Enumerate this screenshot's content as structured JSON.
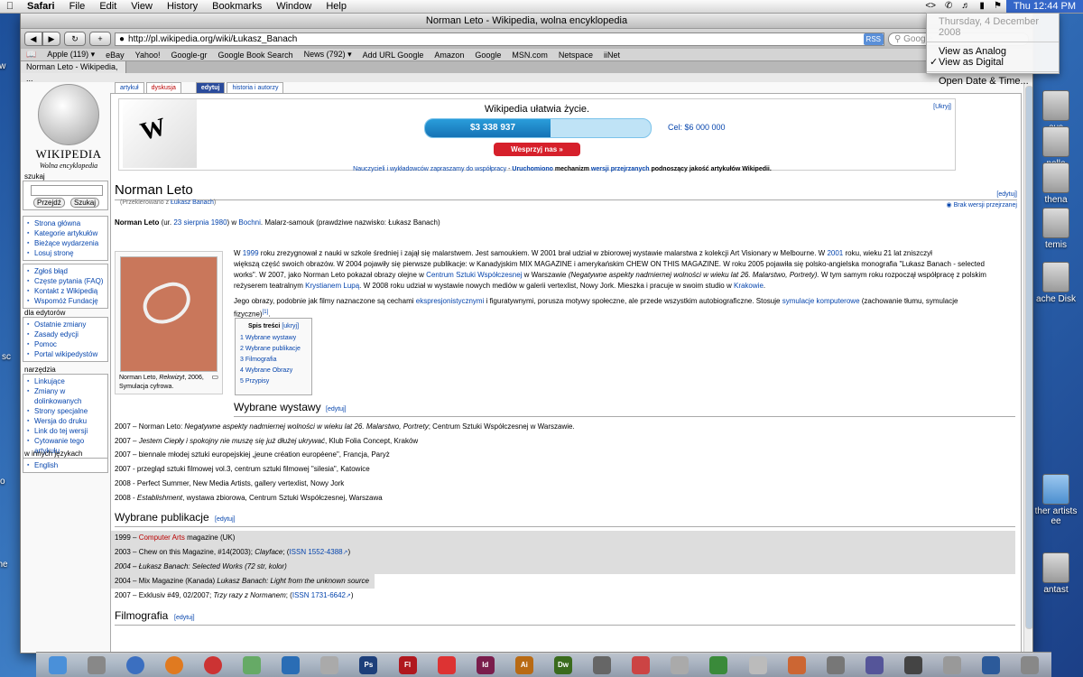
{
  "menubar": {
    "app": "Safari",
    "items": [
      "File",
      "Edit",
      "View",
      "History",
      "Bookmarks",
      "Window",
      "Help"
    ],
    "clock": "Thu 12:44 PM"
  },
  "clock_menu": {
    "date": "Thursday, 4 December 2008",
    "analog": "View as Analog",
    "digital": "View as Digital",
    "open_prefs": "Open Date & Time..."
  },
  "window": {
    "title": "Norman Leto - Wikipedia, wolna encyklopedia",
    "url": "http://pl.wikipedia.org/wiki/Łukasz_Banach",
    "rss": "RSS",
    "search_placeholder": "Google",
    "tab": "Norman Leto - Wikipedia, ...",
    "bookmarks": [
      "Apple (119) ▾",
      "eBay",
      "Yahoo!",
      "Google-gr",
      "Google Book Search",
      "News (792) ▾",
      "Add URL Google",
      "Amazon",
      "Google",
      "MSN.com",
      "Netspace",
      "iiNet"
    ]
  },
  "desktop": {
    "icons": [
      "eus",
      "pollo",
      "thena",
      "temis",
      "ache Disk",
      "ther artists ee",
      "antast"
    ],
    "left_labels": [
      "ow",
      "do sc",
      "bo",
      "The"
    ]
  },
  "wiki": {
    "logo_title": "WIKIPEDIA",
    "logo_sub": "Wolna encyklopedia",
    "search_label": "szukaj",
    "btn_go": "Przejdź",
    "btn_search": "Szukaj",
    "nav": [
      "Strona główna",
      "Kategorie artykułów",
      "Bieżące wydarzenia",
      "Losuj stronę"
    ],
    "help": [
      "Zgłoś błąd",
      "Częste pytania (FAQ)",
      "Kontakt z Wikipedią",
      "Wspomóż Fundację"
    ],
    "editors_label": "dla edytorów",
    "editors": [
      "Ostatnie zmiany",
      "Zasady edycji",
      "Pomoc",
      "Portal wikipedystów"
    ],
    "tools_label": "narzędzia",
    "tools": [
      "Linkujące",
      "Zmiany w dolinkowanych",
      "Strony specjalne",
      "Wersja do druku",
      "Link do tej wersji",
      "Cytowanie tego artykułu"
    ],
    "lang_label": "w innych językach",
    "langs": [
      "English"
    ],
    "tabs": [
      "artykuł",
      "dyskusja",
      "edytuj",
      "historia i autorzy"
    ]
  },
  "banner": {
    "title": "Wikipedia ułatwia życie.",
    "amount": "$3 338 937",
    "progress_fraction": 0.556,
    "goal": "Cel: $6 000 000",
    "donate": "Wesprzyj nas »",
    "hide": "[Ukryj]",
    "notice_a": "Nauczycieli i wykładowców zapraszamy do współpracy",
    "notice_b": " - ",
    "notice_c": "Uruchomiono",
    "notice_d": " mechanizm ",
    "notice_e": "wersji przejrzanych",
    "notice_f": " podnoszący jakość artykułów Wikipedii."
  },
  "article": {
    "title": "Norman Leto",
    "edit": "[edytuj]",
    "redirect_a": "(Przekierowano z ",
    "redirect_b": "Łukasz Banach",
    "redirect_c": ")",
    "unreviewed": "Brak wersji przejrzanej",
    "lead_name": "Norman Leto",
    "lead_a": " (ur. ",
    "lead_date": "23 sierpnia 1980",
    "lead_b": ") w ",
    "lead_city": "Bochni",
    "lead_c": ". Malarz-samouk (prawdziwe nazwisko: Łukasz Banach)",
    "p1_l1a": "W ",
    "p1_1999": "1999",
    "p1_l1b": " roku zrezygnował z nauki w szkole średniej i zajął się malarstwem. Jest samoukiem. W 2001 brał udział w zbiorowej wystawie malarstwa z kolekcji Art Visionary w Melbourne. W ",
    "p1_2001": "2001",
    "p1_l1c": " roku, wieku 21 lat zniszczył",
    "p1_l2": "większą część swoich obrazów. W 2004 pojawiły się pierwsze publikacje: w Kanadyjskim MIX MAGAZINE i amerykańskim CHEW ON THIS MAGAZINE. W roku 2005 pojawiła się polsko-angielska monografia \"Lukasz Banach - selected",
    "p1_l3a": "works\". W 2007, jako Norman Leto pokazał obrazy olejne w ",
    "p1_csw": "Centrum Sztuki Współczesnej",
    "p1_l3b": " w Warszawie ",
    "p1_l3c": "(Negatywne aspekty nadmiernej wolności w wieku lat 26. Malarstwo, Portrety).",
    "p1_l3d": " W tym samym roku rozpoczął współpracę z polskim",
    "p1_l4a": "reżyserem teatralnym ",
    "p1_lupa": "Krystianem Lupą",
    "p1_l4b": ". W 2008 roku udział w wystawie nowych mediów w galerii vertexlist, Nowy Jork. Mieszka i pracuje w swoim studio w ",
    "p1_krk": "Krakowie",
    "p1_l4c": ".",
    "p2_a": "Jego obrazy, podobnie jak filmy naznaczone są cechami ",
    "p2_ekspr": "ekspresjonistycznymi",
    "p2_b": " i figuratywnymi, porusza motywy społeczne, ale przede wszystkim autobiograficzne. Stosuje ",
    "p2_sym": "symulacje komputerowe",
    "p2_c": " (zachowanie tłumu, symulacje",
    "p2_d": "fizyczne)",
    "p2_ref": "[1]",
    "p2_e": ".",
    "caption_a": "Norman Leto, ",
    "caption_b": "Rekwizyt",
    "caption_c": ", 2006, Symulacja cyfrowa.",
    "toc_title": "Spis treści",
    "toc_hide": "[ukryj]",
    "toc": [
      "1 Wybrane wystawy",
      "2 Wybrane publikacje",
      "3 Filmografia",
      "4 Wybrane Obrazy",
      "5 Przypisy"
    ],
    "sec1": "Wybrane wystawy",
    "sec2": "Wybrane publikacje",
    "sec3": "Filmografia",
    "exh1_a": "2007 – Norman Leto: ",
    "exh1_b": "Negatywne aspekty nadmiernej wolności w wieku lat 26. Malarstwo, Portrety",
    "exh1_c": "; Centrum Sztuki Współczesnej w Warszawie.",
    "exh2_a": "2007 – ",
    "exh2_b": "Jestem Ciepły i spokojny nie muszę się już dłużej ukrywać",
    "exh2_c": ", Klub Folia Concept, Kraków",
    "exh3": "2007 – biennale młodej sztuki europejskiej „jeune création européene\", Francja, Paryż",
    "exh4": "2007 - przegląd sztuki filmowej vol.3, centrum sztuki filmowej \"silesia\", Katowice",
    "exh5": "2008 - Perfect Summer, New Media Artists, gallery vertexlist, Nowy Jork",
    "exh6_a": "2008 - ",
    "exh6_b": "Establishment",
    "exh6_c": ", wystawa zbiorowa, Centrum Sztuki Współczesnej, Warszawa",
    "pub1_a": "1999 – ",
    "pub1_b": "Computer Arts",
    "pub1_c": " magazine (UK)",
    "pub2_a": "2003 – Chew on this Magazine, #14(2003); ",
    "pub2_b": "Clayface",
    "pub2_c": "; (",
    "pub2_d": "ISSN 1552-4388",
    "pub2_e": ")",
    "pub3": "2004 – Łukasz Banach: Selected Works (72 str, kolor)",
    "pub4_a": "2004 – Mix Magazine (Kanada) ",
    "pub4_b": "Lukasz Banach: Light from the unknown source",
    "pub5_a": "2007 – Exklusiv #49, 02/2007; ",
    "pub5_b": "Trzy razy z Normanem",
    "pub5_c": "; (",
    "pub5_d": "ISSN 1731-6642",
    "pub5_e": ")"
  },
  "dock": {
    "apps": [
      "Ps",
      "Fl",
      "Id",
      "Ai",
      "Dw"
    ]
  },
  "colors": {
    "link": "#0645ad",
    "redlink": "#ba0000",
    "donate": "#d6202b",
    "clock_bg": "#3567c9"
  }
}
